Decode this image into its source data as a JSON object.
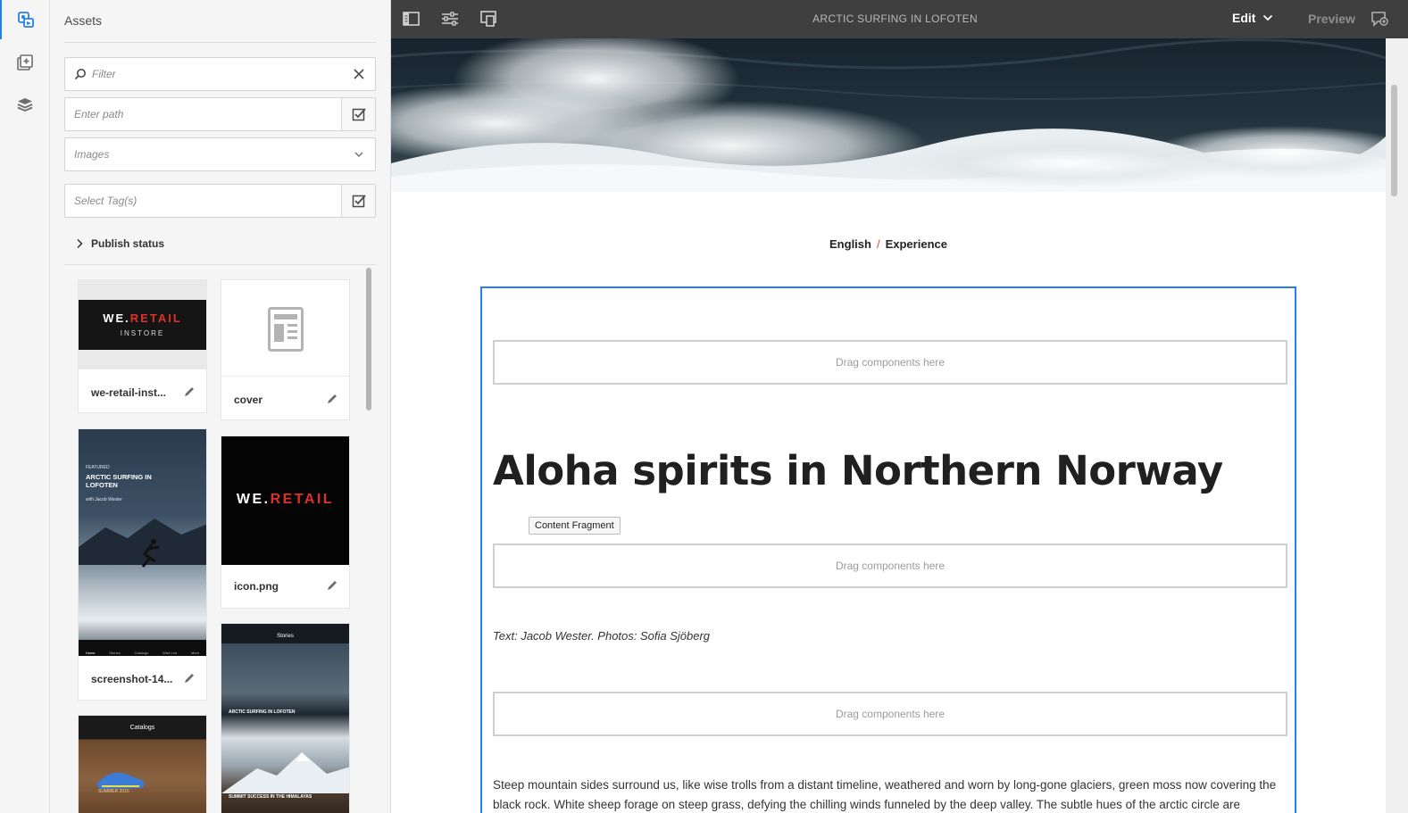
{
  "rail": {
    "items": [
      {
        "icon": "assets-icon",
        "active": true
      },
      {
        "icon": "components-icon",
        "active": false
      },
      {
        "icon": "content-tree-icon",
        "active": false
      }
    ]
  },
  "panel": {
    "title": "Assets",
    "filter": {
      "placeholder": "Filter"
    },
    "path": {
      "placeholder": "Enter path"
    },
    "type_select": {
      "value": "Images"
    },
    "tags": {
      "placeholder": "Select Tag(s)"
    },
    "publish_status": "Publish status",
    "assets": [
      {
        "name": "we-retail-inst...",
        "thumb_title": "WE.",
        "thumb_accent": "RETAIL",
        "thumb_sub": "INSTORE"
      },
      {
        "name": "cover"
      },
      {
        "name": "screenshot-14...",
        "thumb_kicker": "FEATURED",
        "thumb_title": "ARCTIC SURFING IN LOFOTEN",
        "thumb_byline": "with Jacob Wester",
        "tabs": [
          "Home",
          "Stories",
          "Catalogs",
          "Wish List",
          "More"
        ]
      },
      {
        "name": "icon.png",
        "thumb_title": "WE.",
        "thumb_accent": "RETAIL"
      },
      {
        "name": "",
        "thumb_header": "Catalogs",
        "thumb_footer": "SUMMER 2016"
      },
      {
        "name": "",
        "thumb_header": "Stories",
        "thumb_caption_1": "ARCTIC SURFING IN LOFOTEN",
        "thumb_caption_2": "SUMMIT SUCCESS IN THE HIMALAYAS"
      }
    ]
  },
  "topbar": {
    "page_title": "ARCTIC SURFING IN LOFOTEN",
    "mode": "Edit",
    "preview": "Preview"
  },
  "page": {
    "breadcrumb": [
      "English",
      "Experience"
    ],
    "drop_label": "Drag components here",
    "headline": "Aloha spirits in Northern Norway",
    "content_fragment_label": "Content Fragment",
    "byline": "Text: Jacob Wester. Photos: Sofia Sjöberg",
    "body": "Steep mountain sides surround us, like wise trolls from a distant timeline, weathered and worn by long-gone glaciers, green moss now covering the black rock. White sheep forage on steep grass, defying the chilling winds funneled by the deep valley. The subtle hues of the arctic circle are"
  }
}
